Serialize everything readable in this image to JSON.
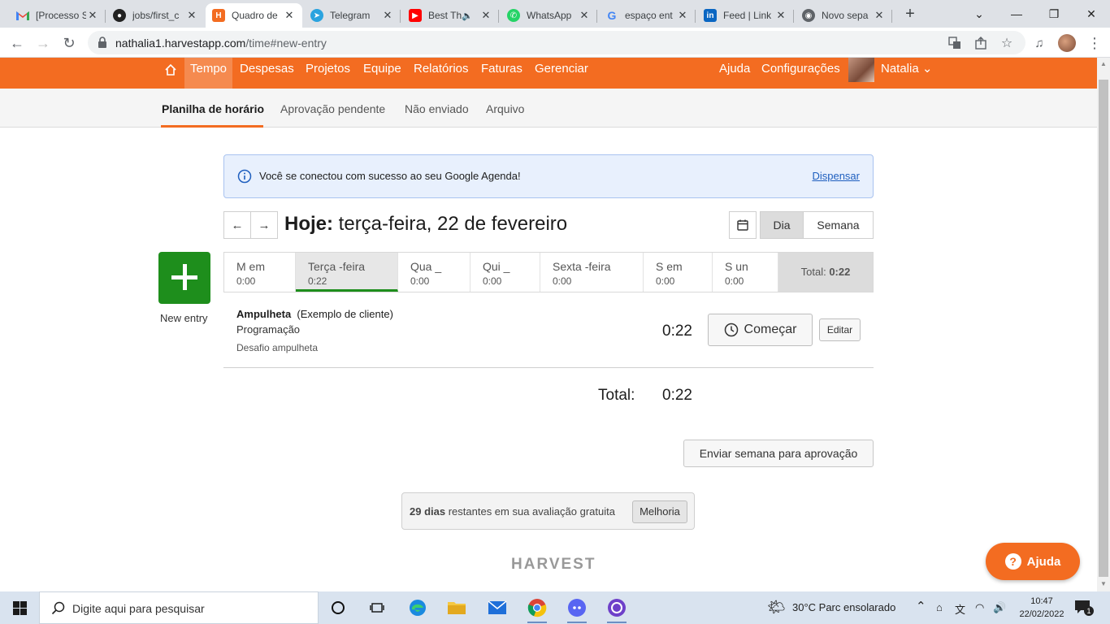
{
  "browser": {
    "tabs": [
      {
        "label": "[Processo S",
        "icon": "gmail-icon"
      },
      {
        "label": "jobs/first_c",
        "icon": "github-icon"
      },
      {
        "label": "Quadro de",
        "icon": "harvest-icon"
      },
      {
        "label": "Telegram",
        "icon": "telegram-icon"
      },
      {
        "label": "Best Th",
        "icon": "youtube-icon"
      },
      {
        "label": "WhatsApp",
        "icon": "whatsapp-icon"
      },
      {
        "label": "espaço ent",
        "icon": "google-icon"
      },
      {
        "label": "Feed | Link",
        "icon": "linkedin-icon"
      },
      {
        "label": "Novo sepa",
        "icon": "chrome-icon"
      }
    ],
    "url_host": "nathalia1.harvestapp.com",
    "url_path": "/time#new-entry"
  },
  "harvest_nav": {
    "items": [
      "Tempo",
      "Despesas",
      "Projetos",
      "Equipe",
      "Relatórios",
      "Faturas",
      "Gerenciar"
    ],
    "right": [
      "Ajuda",
      "Configurações"
    ],
    "user": "Natalia",
    "accent": "#f36c21"
  },
  "subnav": {
    "items": [
      "Planilha de horário",
      "Aprovação pendente",
      "Não enviado",
      "Arquivo"
    ]
  },
  "alert": {
    "text": "Você se conectou com sucesso ao seu Google Agenda!",
    "dismiss": "Dispensar"
  },
  "header": {
    "today_label": "Hoje:",
    "date": "terça-feira, 22 de fevereiro",
    "view_day": "Dia",
    "view_week": "Semana"
  },
  "new_entry": {
    "label": "New entry",
    "color": "#1e8e1c"
  },
  "week": {
    "days": [
      {
        "name": "M em",
        "time": "0:00"
      },
      {
        "name": "Terça -feira",
        "time": "0:22"
      },
      {
        "name": "Qua _",
        "time": "0:00"
      },
      {
        "name": "Qui _",
        "time": "0:00"
      },
      {
        "name": "Sexta -feira",
        "time": "0:00"
      },
      {
        "name": "S em",
        "time": "0:00"
      },
      {
        "name": "S un",
        "time": "0:00"
      }
    ],
    "total_label": "Total:",
    "total_value": "0:22"
  },
  "entry": {
    "project": "Ampulheta",
    "client": "(Exemplo de cliente)",
    "task": "Programação",
    "notes": "Desafio ampulheta",
    "time": "0:22",
    "start_label": "Começar",
    "edit_label": "Editar"
  },
  "totals": {
    "label": "Total:",
    "value": "0:22"
  },
  "submit_label": "Enviar semana para aprovação",
  "trial": {
    "days": "29 dias",
    "text": "restantes em sua avaliação gratuita",
    "upgrade": "Melhoria"
  },
  "logo": "HARVEST",
  "help_label": "Ajuda",
  "taskbar": {
    "search_placeholder": "Digite aqui para pesquisar",
    "weather": "30°C  Parc ensolarado",
    "time": "10:47",
    "date": "22/02/2022",
    "notifications": "1"
  }
}
